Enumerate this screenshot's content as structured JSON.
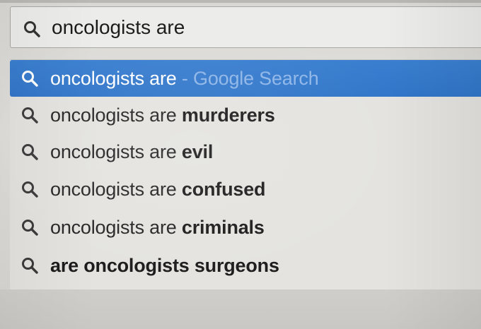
{
  "omnibox": {
    "value": "oncologists are",
    "icon": "search-icon"
  },
  "suggestions": [
    {
      "prefix": "oncologists are",
      "bold": "",
      "separator": " - ",
      "hint": "Google Search",
      "icon": "search-icon",
      "selected": true
    },
    {
      "prefix": "oncologists are ",
      "bold": "murderers",
      "icon": "search-icon",
      "selected": false
    },
    {
      "prefix": "oncologists are ",
      "bold": "evil",
      "icon": "search-icon",
      "selected": false
    },
    {
      "prefix": "oncologists are ",
      "bold": "confused",
      "icon": "search-icon",
      "selected": false
    },
    {
      "prefix": "oncologists are ",
      "bold": "criminals",
      "icon": "search-icon",
      "selected": false
    },
    {
      "prefix": "",
      "bold": "are oncologists surgeons",
      "icon": "search-icon",
      "selected": false
    }
  ],
  "colors": {
    "selection": "#3578cc",
    "hint_text": "#8fb6e8",
    "background": "#e1e0dc"
  }
}
